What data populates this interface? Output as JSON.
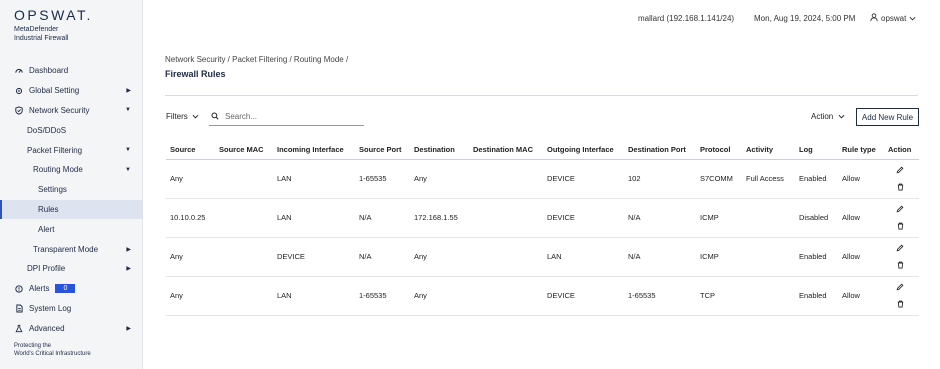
{
  "brand": {
    "logo_text": "OPSWAT.",
    "product_line1": "MetaDefender",
    "product_line2": "Industrial Firewall",
    "tagline_line1": "Protecting the",
    "tagline_line2": "World's Critical Infrastructure"
  },
  "sidebar": {
    "items": [
      {
        "label": "Dashboard",
        "icon": "dashboard-icon"
      },
      {
        "label": "Global Setting",
        "icon": "gear-icon"
      },
      {
        "label": "Network Security",
        "icon": "shield-icon"
      },
      {
        "label": "DoS/DDoS"
      },
      {
        "label": "Packet Filtering"
      },
      {
        "label": "Routing Mode"
      },
      {
        "label": "Settings"
      },
      {
        "label": "Rules"
      },
      {
        "label": "Alert"
      },
      {
        "label": "Transparent Mode"
      },
      {
        "label": "DPI Profile"
      },
      {
        "label": "Alerts",
        "icon": "alert-icon",
        "badge": "0"
      },
      {
        "label": "System Log",
        "icon": "document-icon"
      },
      {
        "label": "Advanced",
        "icon": "flask-icon"
      }
    ],
    "active": "Rules"
  },
  "header": {
    "host": "mallard (192.168.1.141/24)",
    "datetime": "Mon, Aug 19, 2024, 5:00 PM",
    "username": "opswat"
  },
  "main": {
    "breadcrumb": "Network Security / Packet Filtering / Routing Mode /",
    "title": "Firewall Rules",
    "filters_label": "Filters",
    "search_placeholder": "Search...",
    "action_label": "Action",
    "add_rule_label": "Add New Rule"
  },
  "table": {
    "headers": [
      "Source",
      "Source MAC",
      "Incoming Interface",
      "Source Port",
      "Destination",
      "Destination MAC",
      "Outgoing Interface",
      "Destination Port",
      "Protocol",
      "Activity",
      "Log",
      "Rule type",
      "Action"
    ],
    "rows": [
      [
        "Any",
        "",
        "LAN",
        "1-65535",
        "Any",
        "",
        "DEVICE",
        "102",
        "S7COMM",
        "Full Access",
        "Enabled",
        "Allow"
      ],
      [
        "10.10.0.25",
        "",
        "LAN",
        "N/A",
        "172.168.1.55",
        "",
        "DEVICE",
        "N/A",
        "ICMP",
        "",
        "Disabled",
        "Allow"
      ],
      [
        "Any",
        "",
        "DEVICE",
        "N/A",
        "Any",
        "",
        "LAN",
        "N/A",
        "ICMP",
        "",
        "Enabled",
        "Allow"
      ],
      [
        "Any",
        "",
        "LAN",
        "1-65535",
        "Any",
        "",
        "DEVICE",
        "1-65535",
        "TCP",
        "",
        "Enabled",
        "Allow"
      ]
    ]
  },
  "colors": {
    "accent": "#2456d6",
    "active_nav_bg": "#dde3ef",
    "sidebar_bg": "#f4f5f7",
    "brand_text": "#1b2a4a"
  }
}
